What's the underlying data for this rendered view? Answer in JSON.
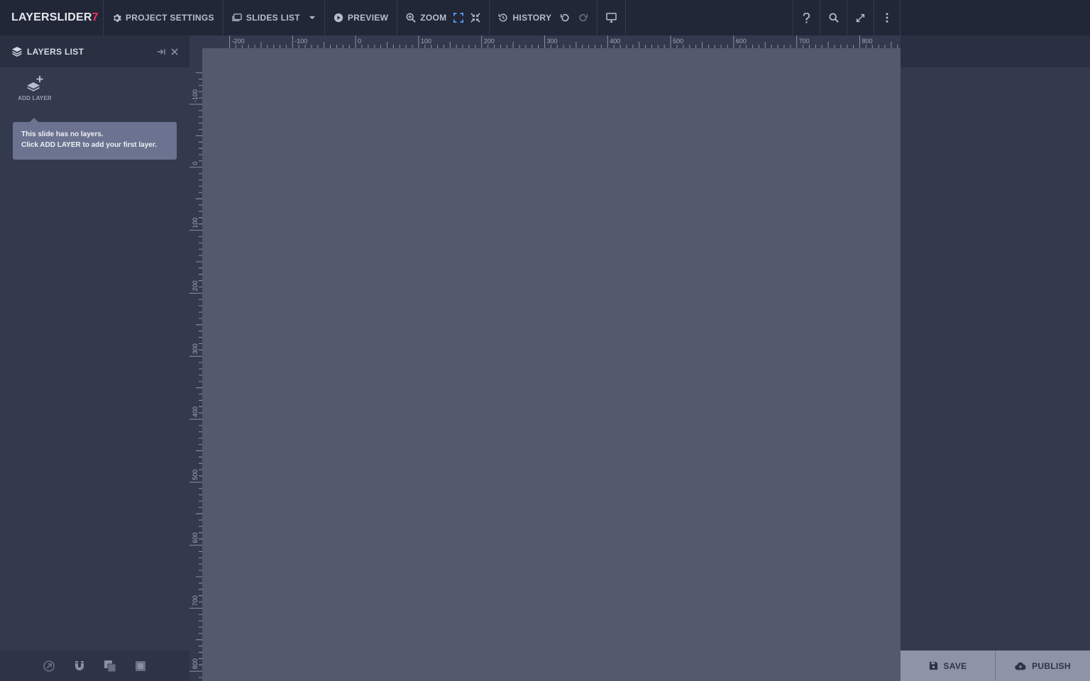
{
  "app": {
    "logo_text": "LAYERSLIDER",
    "logo_version": "7"
  },
  "toolbar": {
    "project_settings": "PROJECT SETTINGS",
    "slides_list": "SLIDES LIST",
    "preview": "PREVIEW",
    "zoom": "ZOOM",
    "history": "HISTORY"
  },
  "layers_panel": {
    "title": "LAYERS LIST",
    "add_layer": "ADD LAYER",
    "empty_line1": "This slide has no layers.",
    "empty_line2": "Click ADD LAYER to add your first layer."
  },
  "ruler": {
    "horizontal_labels": [
      "-200",
      "-100",
      "0",
      "100",
      "200",
      "300",
      "400",
      "500",
      "600",
      "700",
      "800"
    ],
    "vertical_labels": [
      "-100",
      "0",
      "100",
      "200",
      "300",
      "400",
      "500",
      "600",
      "700",
      "800"
    ]
  },
  "actions": {
    "save": "SAVE",
    "publish": "PUBLISH"
  },
  "colors": {
    "accent": "#ff2f5f",
    "topbar": "#222737",
    "canvas": "#535a6d",
    "panel": "#343a4d",
    "zoom_fit": "#5b9bff"
  }
}
